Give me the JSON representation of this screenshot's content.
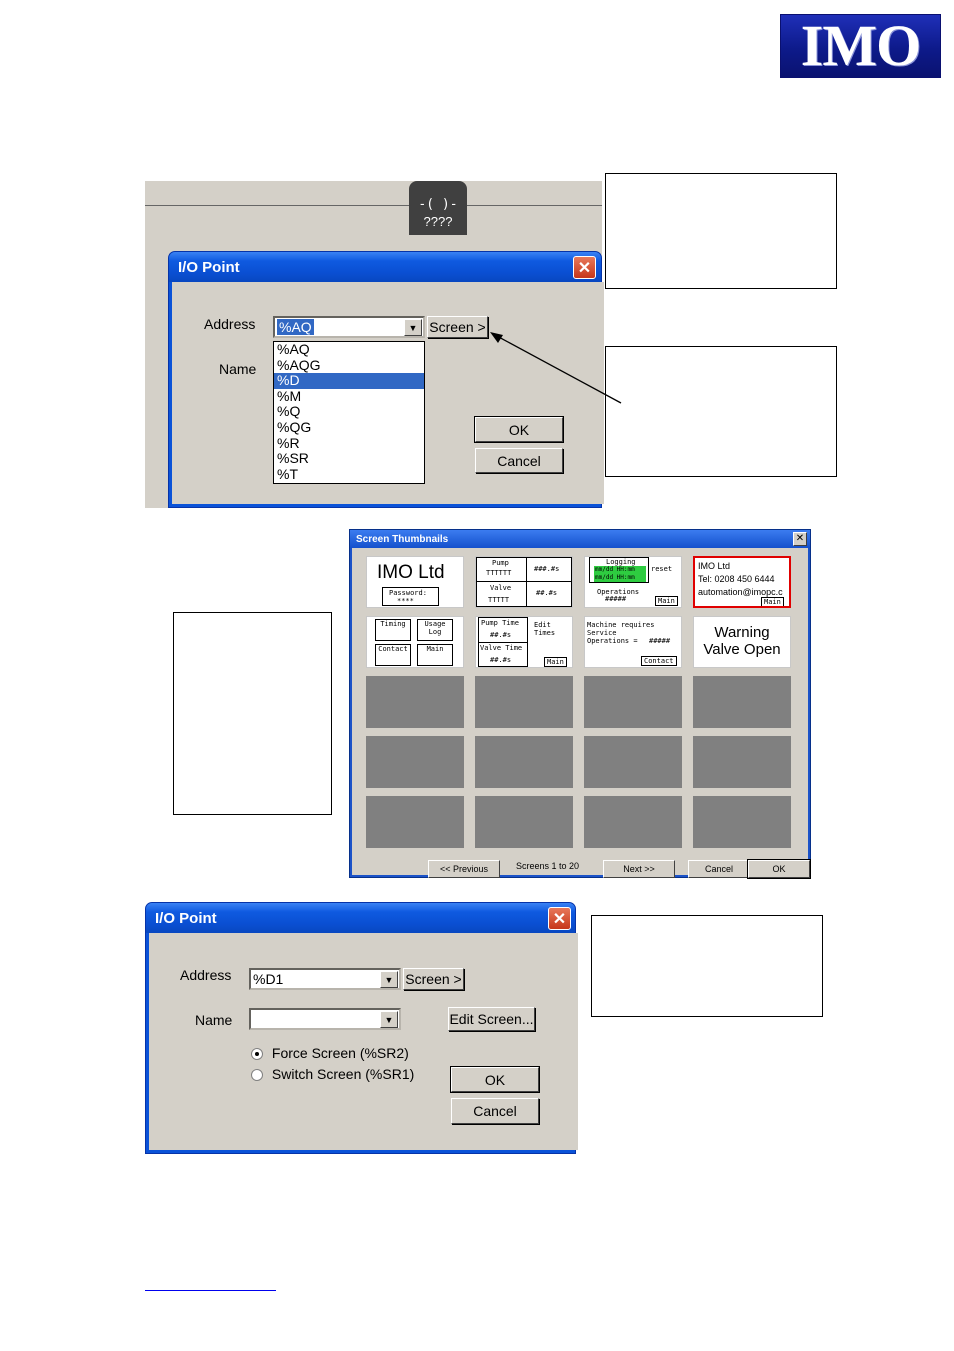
{
  "logo": {
    "text": "IMO"
  },
  "ladder": {
    "coil_label": "????",
    "coil_symbol": "-( )-"
  },
  "dialog1": {
    "title": "I/O Point",
    "address_label": "Address",
    "address_value": "%AQ",
    "name_label": "Name",
    "screen_button": "Screen >",
    "ok_button": "OK",
    "cancel_button": "Cancel",
    "options": [
      "%AQ",
      "%AQG",
      "%D",
      "%M",
      "%Q",
      "%QG",
      "%R",
      "%SR",
      "%T"
    ],
    "selected_option": "%D"
  },
  "thumbnails": {
    "title": "Screen Thumbnails",
    "previous_button": "<< Previous",
    "range_text": "Screens 1 to 20",
    "next_button": "Next >>",
    "cancel_button": "Cancel",
    "ok_button": "OK",
    "tile1": {
      "title": "IMO Ltd",
      "password_label": "Password:",
      "password_value": "****"
    },
    "tile2": {
      "pump": "Pump",
      "pump_val": "TTTTTT",
      "pump_num": "###.#s",
      "valve": "Valve",
      "valve_val": "TTTTT",
      "valve_num": "##.#s"
    },
    "tile3": {
      "logging": "Logging",
      "row1": "mm/dd HH:mm",
      "reset": "reset",
      "operations": "Operations",
      "ops_val": "#####",
      "main": "Main"
    },
    "tile4": {
      "company": "IMO Ltd",
      "tel": "Tel: 0208 450 6444",
      "email": "automation@imopc.c",
      "main": "Main"
    },
    "tile5": {
      "timing": "Timing",
      "usage": "Usage Log",
      "contact": "Contact",
      "main": "Main"
    },
    "tile6": {
      "pump_time": "Pump Time",
      "pump_val": "##.#s",
      "valve_time": "Valve Time",
      "valve_val": "##.#s",
      "edit": "Edit Times",
      "main": "Main"
    },
    "tile7": {
      "line1": "Machine requires",
      "line2": "Service",
      "line3": "Operations =",
      "ops": "#####",
      "contact": "Contact"
    },
    "tile8": {
      "line1": "Warning",
      "line2": "Valve Open"
    }
  },
  "dialog2": {
    "title": "I/O Point",
    "address_label": "Address",
    "address_value": "%D1",
    "name_label": "Name",
    "name_value": "",
    "screen_button": "Screen >",
    "edit_screen_button": "Edit Screen...",
    "force_screen": "Force Screen (%SR2)",
    "switch_screen": "Switch Screen (%SR1)",
    "ok_button": "OK",
    "cancel_button": "Cancel"
  }
}
